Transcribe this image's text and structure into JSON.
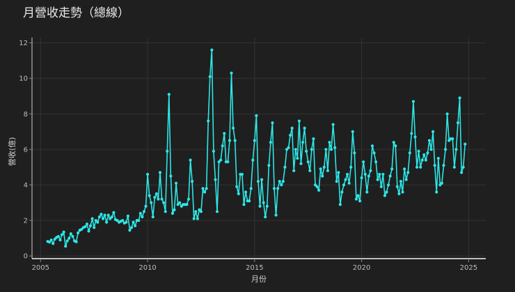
{
  "chart_data": {
    "type": "line",
    "title": "月營收走勢（總線）",
    "xlabel": "月份",
    "ylabel": "營收(億)",
    "xlim": [
      2004.6,
      2025.8
    ],
    "ylim": [
      -0.15,
      12.3
    ],
    "x_ticks": [
      2005,
      2010,
      2015,
      2020,
      2025
    ],
    "y_ticks": [
      0,
      2,
      4,
      6,
      8,
      10,
      12
    ],
    "grid": true,
    "line_color": "#2ee6e6",
    "background": "#1f1f1f",
    "start": "2005-05",
    "values": [
      0.82,
      0.78,
      0.9,
      0.7,
      0.95,
      1.05,
      1.1,
      0.9,
      1.2,
      1.35,
      0.55,
      0.85,
      1.0,
      1.25,
      1.1,
      0.85,
      0.8,
      1.3,
      1.45,
      1.5,
      1.6,
      1.65,
      1.8,
      1.4,
      1.7,
      2.1,
      1.6,
      2.0,
      1.9,
      2.2,
      2.35,
      2.1,
      2.3,
      1.9,
      2.3,
      2.1,
      2.2,
      2.45,
      2.05,
      2.0,
      1.9,
      1.95,
      2.0,
      1.85,
      1.9,
      2.25,
      1.45,
      1.6,
      1.9,
      1.7,
      2.0,
      2.0,
      2.4,
      2.2,
      2.5,
      2.8,
      4.6,
      3.4,
      3.0,
      2.2,
      3.3,
      3.5,
      3.2,
      4.7,
      3.2,
      3.0,
      2.5,
      5.9,
      9.1,
      4.5,
      2.4,
      2.6,
      4.1,
      2.9,
      3.0,
      2.8,
      2.9,
      2.9,
      2.9,
      3.2,
      5.4,
      4.2,
      2.1,
      2.5,
      2.1,
      2.6,
      2.5,
      3.8,
      3.6,
      3.8,
      7.6,
      10.1,
      11.6,
      5.9,
      4.3,
      2.5,
      5.3,
      5.4,
      6.2,
      6.9,
      5.3,
      5.3,
      6.5,
      10.3,
      7.2,
      6.5,
      3.9,
      3.5,
      4.6,
      4.6,
      2.9,
      3.6,
      3.1,
      3.1,
      3.8,
      5.4,
      6.5,
      7.9,
      4.2,
      2.8,
      4.3,
      3.0,
      2.2,
      2.8,
      5.1,
      6.4,
      7.5,
      3.8,
      2.3,
      3.8,
      4.2,
      4.0,
      4.2,
      5.0,
      6.0,
      6.1,
      6.8,
      7.2,
      4.8,
      6.0,
      5.5,
      7.6,
      5.2,
      6.4,
      7.2,
      5.9,
      5.3,
      4.8,
      6.0,
      6.6,
      4.0,
      3.9,
      3.7,
      4.9,
      4.5,
      5.0,
      6.0,
      4.8,
      6.4,
      6.0,
      7.4,
      6.1,
      4.2,
      4.7,
      2.9,
      3.6,
      4.0,
      4.3,
      4.6,
      4.1,
      5.0,
      7.0,
      5.8,
      3.2,
      3.4,
      3.1,
      4.4,
      5.3,
      4.6,
      3.6,
      4.5,
      4.8,
      6.2,
      5.8,
      5.3,
      4.3,
      4.6,
      3.9,
      4.6,
      3.4,
      3.6,
      4.0,
      4.5,
      4.9,
      6.4,
      6.2,
      3.9,
      3.5,
      4.2,
      3.6,
      4.9,
      4.3,
      4.7,
      5.8,
      6.9,
      8.7,
      6.7,
      5.0,
      5.9,
      5.0,
      5.4,
      5.7,
      5.4,
      5.8,
      6.5,
      6.0,
      7.0,
      5.1,
      3.6,
      5.5,
      4.0,
      4.1,
      5.1,
      6.0,
      8.0,
      6.5,
      6.6,
      6.6,
      5.0,
      6.0,
      7.5,
      8.9,
      4.7,
      5.0,
      6.3
    ]
  }
}
